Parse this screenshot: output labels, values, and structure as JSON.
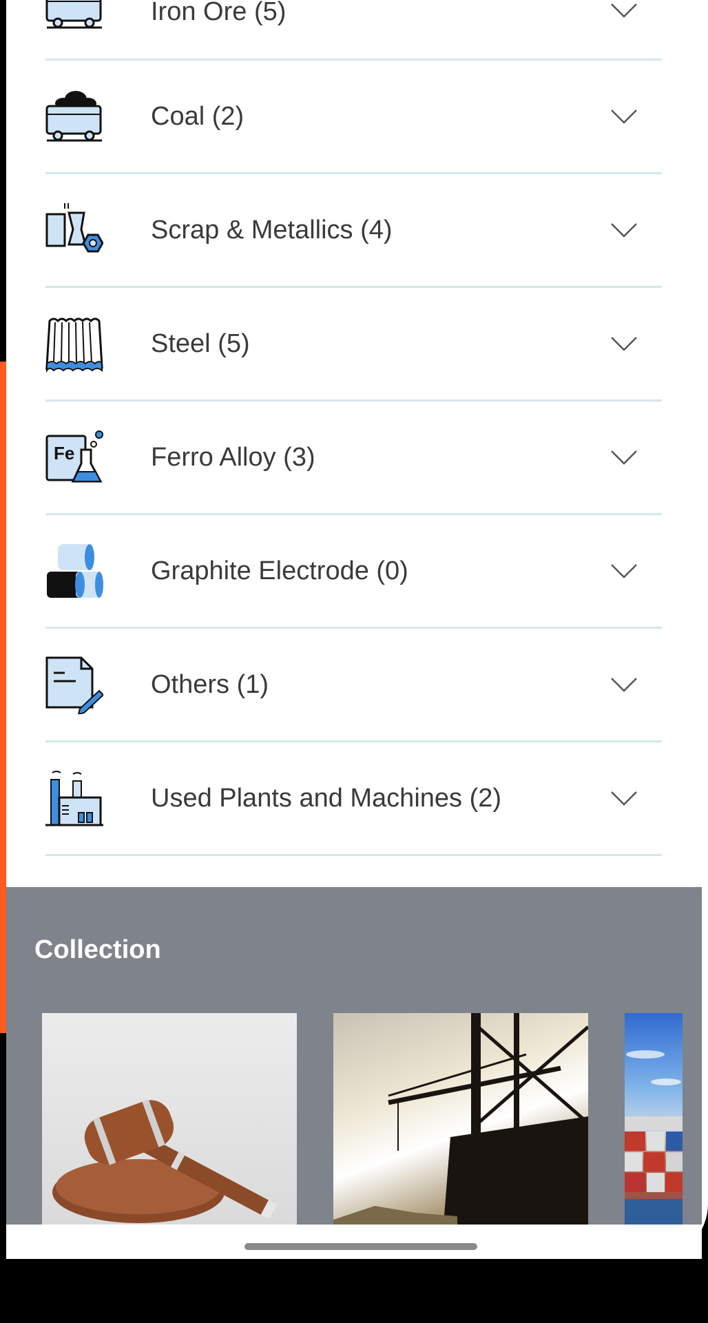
{
  "categories": [
    {
      "label": "Iron Ore (5)",
      "icon": "mine-cart-icon"
    },
    {
      "label": "Coal (2)",
      "icon": "coal-cart-icon"
    },
    {
      "label": "Scrap & Metallics (4)",
      "icon": "scrap-metal-icon"
    },
    {
      "label": "Steel (5)",
      "icon": "steel-sheet-icon"
    },
    {
      "label": "Ferro Alloy (3)",
      "icon": "ferro-alloy-icon"
    },
    {
      "label": "Graphite Electrode (0)",
      "icon": "graphite-electrode-icon"
    },
    {
      "label": "Others (1)",
      "icon": "document-edit-icon"
    },
    {
      "label": "Used Plants and Machines (2)",
      "icon": "factory-icon"
    }
  ],
  "collection": {
    "title": "Collection",
    "cards": [
      {
        "image": "gavel-image"
      },
      {
        "image": "crane-image"
      },
      {
        "image": "containers-image"
      }
    ]
  },
  "colors": {
    "icon_blue": "#cfe3f6",
    "icon_accent": "#3d8ee0",
    "divider": "#d6e6ec",
    "collection_bg": "#7e838c",
    "edge_orange": "#ff5a1f"
  }
}
